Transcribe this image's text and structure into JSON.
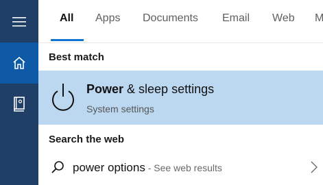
{
  "rail": {
    "items": [
      {
        "icon": "hamburger-menu-icon"
      },
      {
        "icon": "home-icon",
        "active": true
      },
      {
        "icon": "notebook-icon"
      }
    ],
    "colors": {
      "rail": "#1f3f66",
      "active": "#0e5aa6"
    }
  },
  "tabs": [
    {
      "label": "All",
      "active": true
    },
    {
      "label": "Apps"
    },
    {
      "label": "Documents"
    },
    {
      "label": "Email"
    },
    {
      "label": "Web"
    },
    {
      "label": "M"
    }
  ],
  "best_match": {
    "section_label": "Best match",
    "icon": "power-icon",
    "title_bold": "Power",
    "title_rest": " & sleep settings",
    "subtitle": "System settings",
    "highlight_color": "#bcd8f1"
  },
  "web": {
    "section_label": "Search the web",
    "icon": "search-icon",
    "query": "power options",
    "separator": " - ",
    "suffix": "See web results",
    "chevron_icon": "chevron-right-icon"
  },
  "colors": {
    "accent": "#0f74d0"
  }
}
